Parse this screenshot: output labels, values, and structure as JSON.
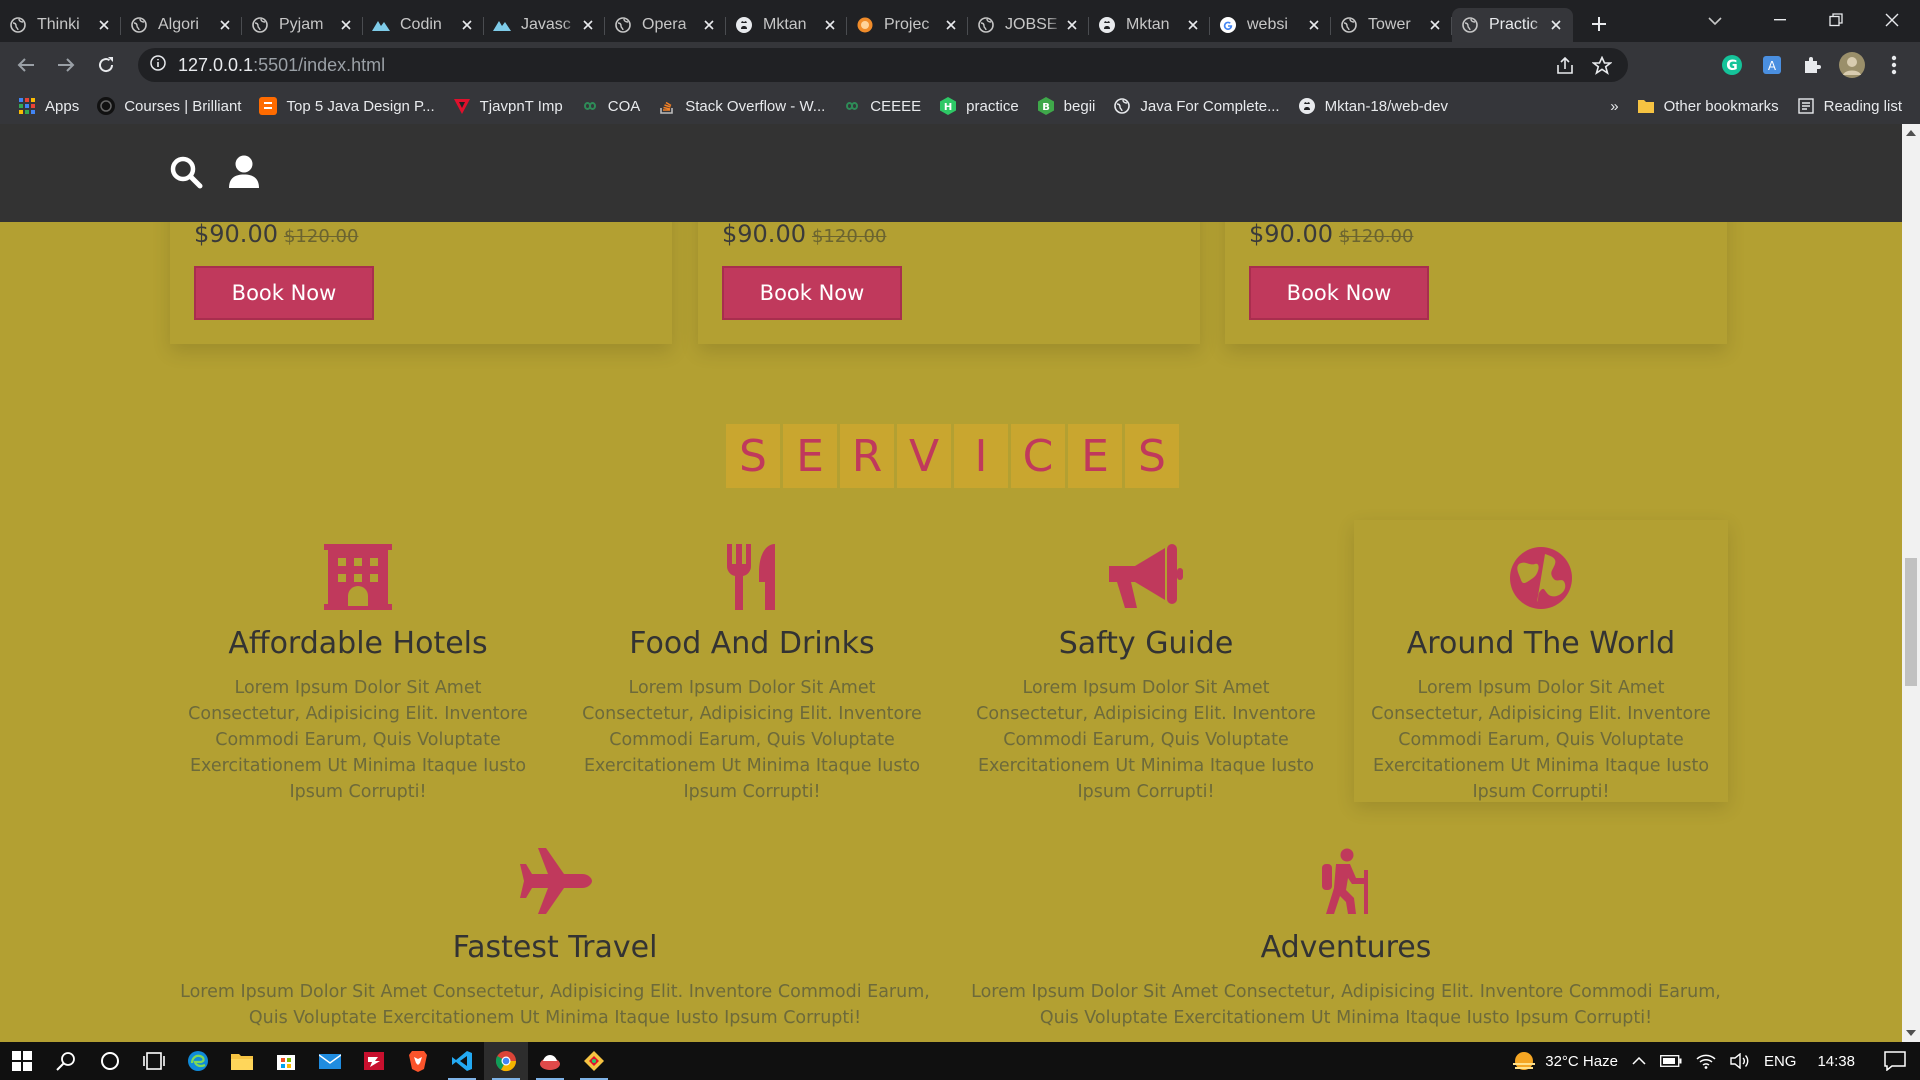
{
  "browser": {
    "tabs": [
      {
        "title": "Thinki",
        "icon": "globe-icon"
      },
      {
        "title": "Algori",
        "icon": "globe-icon"
      },
      {
        "title": "Pyjam",
        "icon": "globe-icon"
      },
      {
        "title": "Codin",
        "icon": "mountain-icon"
      },
      {
        "title": "Javasc",
        "icon": "mountain-icon"
      },
      {
        "title": "Opera",
        "icon": "globe-icon"
      },
      {
        "title": "Mktan",
        "icon": "github-icon"
      },
      {
        "title": "Projec",
        "icon": "orange-circle-icon"
      },
      {
        "title": "JOBSE",
        "icon": "globe-icon"
      },
      {
        "title": "Mktan",
        "icon": "github-icon"
      },
      {
        "title": "websi",
        "icon": "google-icon"
      },
      {
        "title": "Tower",
        "icon": "globe-icon"
      },
      {
        "title": "Practic",
        "icon": "globe-icon",
        "active": true
      }
    ],
    "url_host": "127.0.0.1",
    "url_path": ":5501/index.html",
    "bookmarks": [
      {
        "label": "Apps",
        "icon": "apps-grid-icon"
      },
      {
        "label": "Courses | Brilliant",
        "icon": "brilliant-icon"
      },
      {
        "label": "Top 5 Java Design P...",
        "icon": "blogger-icon"
      },
      {
        "label": "TjavpnT Imp",
        "icon": "red-triangle-icon"
      },
      {
        "label": "COA",
        "icon": "infinity-icon"
      },
      {
        "label": "Stack Overflow - W...",
        "icon": "stackoverflow-icon"
      },
      {
        "label": "CEEEE",
        "icon": "infinity-icon"
      },
      {
        "label": "practice",
        "icon": "hackerrank-icon"
      },
      {
        "label": "begii",
        "icon": "green-b-icon"
      },
      {
        "label": "Java For Complete...",
        "icon": "globe-icon"
      },
      {
        "label": "Mktan-18/web-dev",
        "icon": "github-icon"
      }
    ],
    "overflow": "»",
    "other_bookmarks": "Other bookmarks",
    "reading_list": "Reading list"
  },
  "page": {
    "cards": [
      {
        "price": "$90.00",
        "old_price": "$120.00",
        "button": "Book Now"
      },
      {
        "price": "$90.00",
        "old_price": "$120.00",
        "button": "Book Now"
      },
      {
        "price": "$90.00",
        "old_price": "$120.00",
        "button": "Book Now"
      }
    ],
    "section_heading": [
      "S",
      "E",
      "R",
      "V",
      "I",
      "C",
      "E",
      "S"
    ],
    "services": [
      {
        "title": "Affordable Hotels",
        "icon": "hotel-icon",
        "text": "Lorem Ipsum Dolor Sit Amet Consectetur, Adipisicing Elit. Inventore Commodi Earum, Quis Voluptate Exercitationem Ut Minima Itaque Iusto Ipsum Corrupti!"
      },
      {
        "title": "Food And Drinks",
        "icon": "utensils-icon",
        "text": "Lorem Ipsum Dolor Sit Amet Consectetur, Adipisicing Elit. Inventore Commodi Earum, Quis Voluptate Exercitationem Ut Minima Itaque Iusto Ipsum Corrupti!"
      },
      {
        "title": "Safty Guide",
        "icon": "bullhorn-icon",
        "text": "Lorem Ipsum Dolor Sit Amet Consectetur, Adipisicing Elit. Inventore Commodi Earum, Quis Voluptate Exercitationem Ut Minima Itaque Iusto Ipsum Corrupti!"
      },
      {
        "title": "Around The World",
        "icon": "globe-world-icon",
        "text": "Lorem Ipsum Dolor Sit Amet Consectetur, Adipisicing Elit. Inventore Commodi Earum, Quis Voluptate Exercitationem Ut Minima Itaque Iusto Ipsum Corrupti!"
      },
      {
        "title": "Fastest Travel",
        "icon": "plane-icon",
        "text": "Lorem Ipsum Dolor Sit Amet Consectetur, Adipisicing Elit. Inventore Commodi Earum, Quis Voluptate Exercitationem Ut Minima Itaque Iusto Ipsum Corrupti!"
      },
      {
        "title": "Adventures",
        "icon": "hiking-icon",
        "text": "Lorem Ipsum Dolor Sit Amet Consectetur, Adipisicing Elit. Inventore Commodi Earum, Quis Voluptate Exercitationem Ut Minima Itaque Iusto Ipsum Corrupti!"
      }
    ]
  },
  "taskbar": {
    "weather": "32°C Haze",
    "language": "ENG",
    "time": "14:38"
  },
  "colors": {
    "page_bg": "#b3a032",
    "accent": "#c0395c",
    "header_bg": "#333333",
    "heading_tile": "#c9a62f"
  }
}
